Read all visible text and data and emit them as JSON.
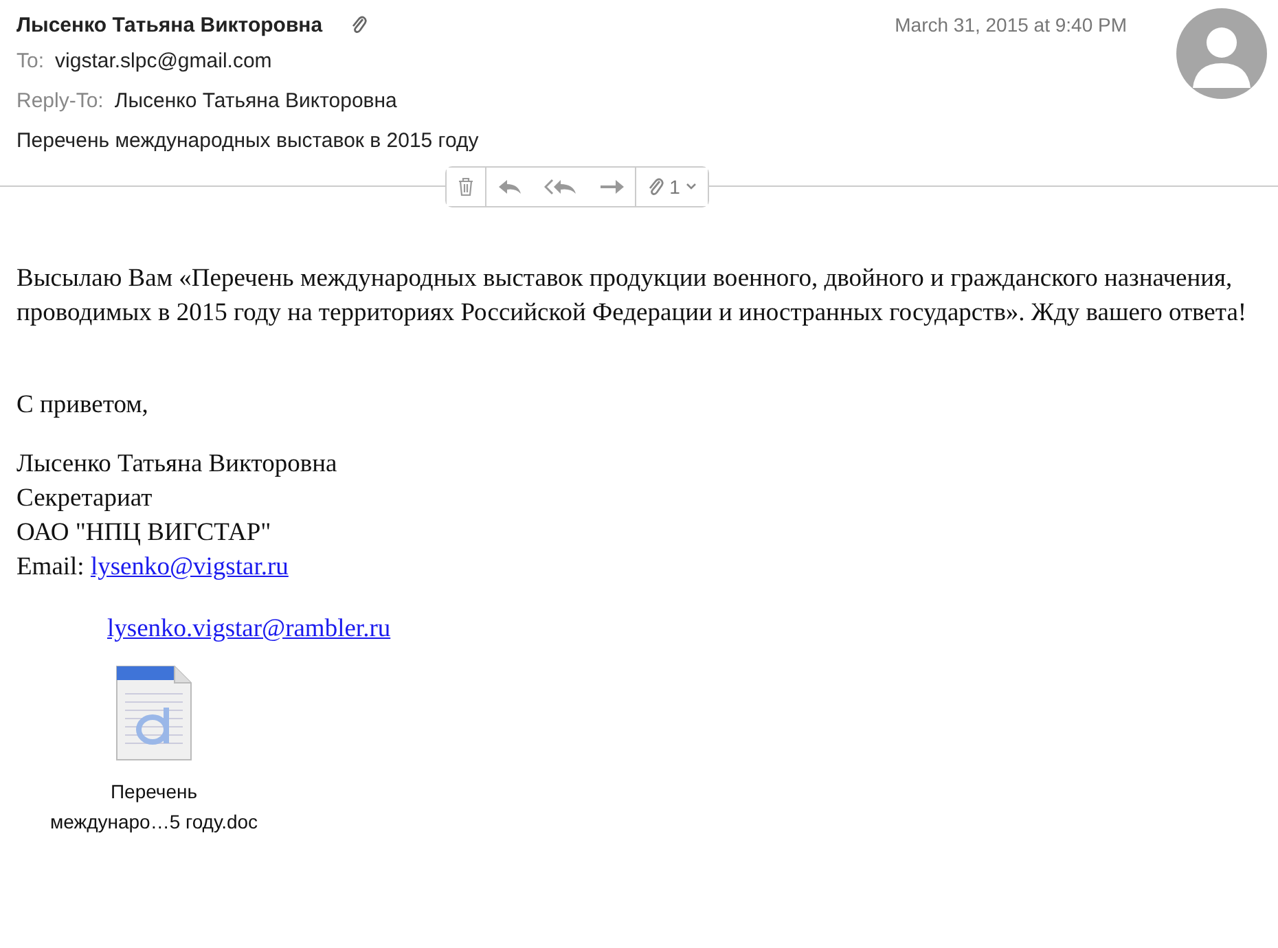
{
  "header": {
    "sender": "Лысенко Татьяна Викторовна",
    "has_attachment": true,
    "date": "March 31, 2015 at 9:40 PM",
    "to_label": "To:",
    "to": "vigstar.slpc@gmail.com",
    "reply_to_label": "Reply-To:",
    "reply_to": "Лысенко Татьяна Викторовна",
    "subject": "Перечень международных выставок в 2015 году"
  },
  "toolbar": {
    "attachment_count": "1"
  },
  "body": {
    "paragraph": "Высылаю Вам «Перечень международных выставок продукции военного, двойного и гражданского назначения, проводимых в 2015 году на территориях Российской Федерации и иностранных государств». Жду вашего ответа!",
    "greeting": "С приветом,",
    "signature": [
      "Лысенко Татьяна Викторовна",
      "Секретариат",
      "ОАО \"НПЦ ВИГСТАР\""
    ],
    "email_label": "Email:",
    "email": "lysenko@vigstar.ru",
    "email2": "lysenko.vigstar@rambler.ru"
  },
  "attachment": {
    "name_line1": "Перечень",
    "name_line2": "междунаро…5 году.doc"
  }
}
